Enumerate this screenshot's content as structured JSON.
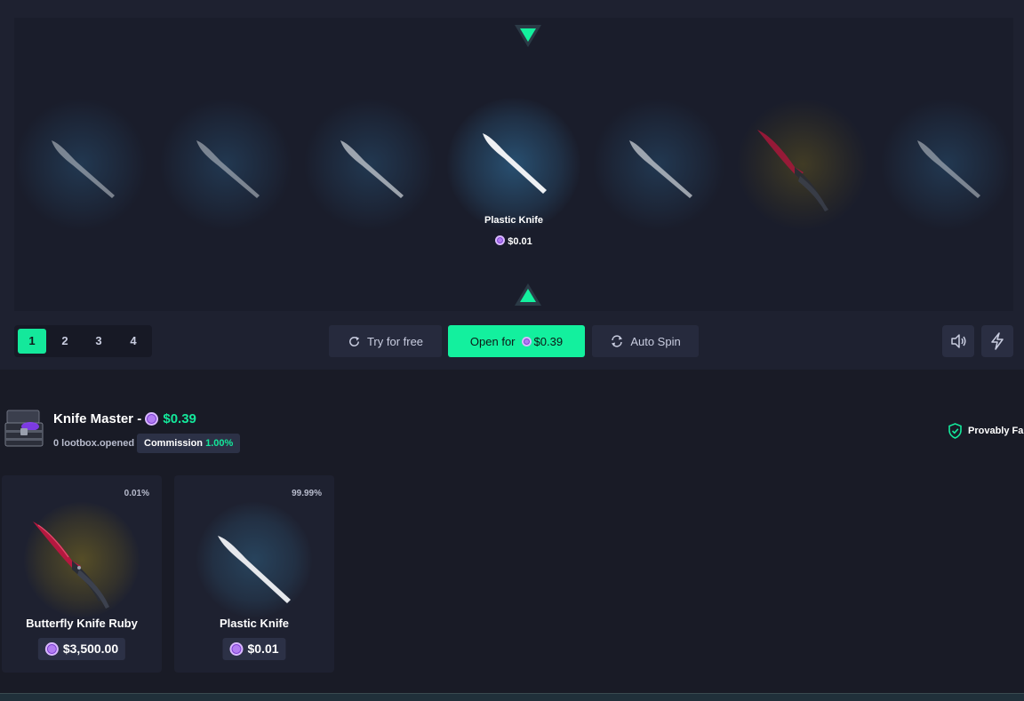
{
  "spinner": {
    "winner_name": "Plastic Knife",
    "winner_price": "$0.01",
    "reel": [
      {
        "item": "plastic-knife",
        "glow": "blue"
      },
      {
        "item": "plastic-knife",
        "glow": "blue"
      },
      {
        "item": "plastic-knife",
        "glow": "blue"
      },
      {
        "item": "plastic-knife",
        "glow": "blue-center"
      },
      {
        "item": "plastic-knife",
        "glow": "blue"
      },
      {
        "item": "butterfly-knife-ruby",
        "glow": "gold"
      },
      {
        "item": "plastic-knife",
        "glow": "blue"
      }
    ]
  },
  "controls": {
    "pages": [
      "1",
      "2",
      "3",
      "4"
    ],
    "active_page": "1",
    "try_free_label": "Try for free",
    "open_label": "Open for",
    "open_price": "$0.39",
    "auto_spin_label": "Auto Spin"
  },
  "case": {
    "title": "Knife Master -",
    "price": "$0.39",
    "opened": "0 lootbox.opened",
    "commission_label": "Commission",
    "commission_value": "1.00%",
    "provably_fair": "Provably Fair"
  },
  "items": [
    {
      "name": "Butterfly Knife Ruby",
      "price": "$3,500.00",
      "chance": "0.01%",
      "glow": "gold"
    },
    {
      "name": "Plastic Knife",
      "price": "$0.01",
      "chance": "99.99%",
      "glow": "blue"
    }
  ],
  "colors": {
    "accent": "#13f09e",
    "background": "#191b26",
    "panel": "#1e2130",
    "coin": "#b27cf2"
  }
}
